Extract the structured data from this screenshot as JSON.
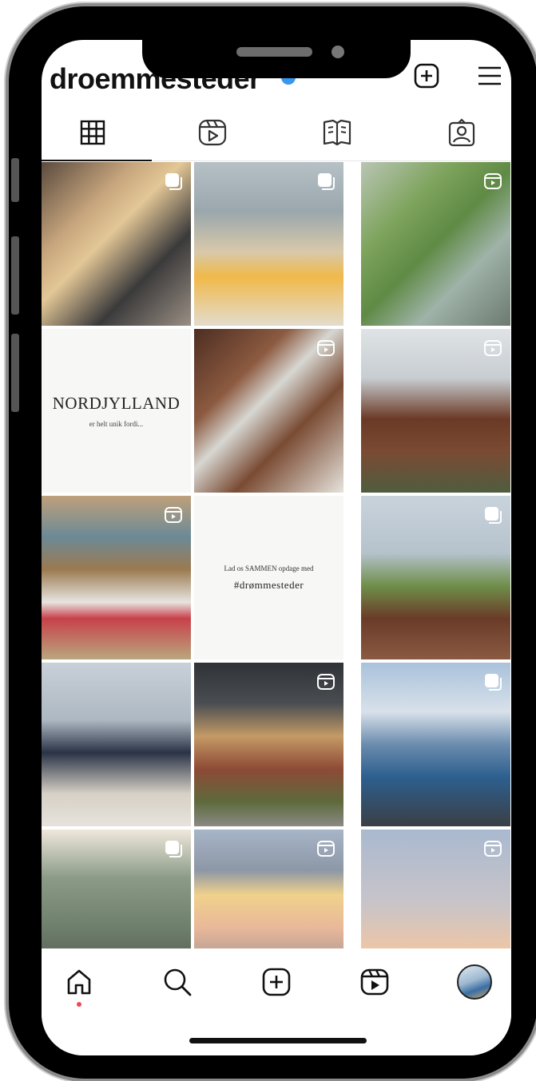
{
  "profile": {
    "username": "droemmesteder"
  },
  "tabs": [
    {
      "name": "posts-grid",
      "icon": "grid-icon",
      "active": true
    },
    {
      "name": "reels",
      "icon": "reels-icon",
      "active": false
    },
    {
      "name": "guides",
      "icon": "guide-icon",
      "active": false
    },
    {
      "name": "tagged",
      "icon": "tagged-icon",
      "active": false
    }
  ],
  "grid": {
    "tile_text_1": {
      "title": "NORDJYLLAND",
      "subtitle": "er helt unik fordi..."
    },
    "tile_text_2": {
      "line1": "Lad os SAMMEN opdage med",
      "line2": "#drømmesteder"
    }
  },
  "bottom_nav": [
    {
      "name": "home",
      "icon": "home-icon",
      "active": true
    },
    {
      "name": "search",
      "icon": "search-icon",
      "active": false
    },
    {
      "name": "create",
      "icon": "plus-square-icon",
      "active": false
    },
    {
      "name": "reels",
      "icon": "reels-icon",
      "active": false
    },
    {
      "name": "profile",
      "icon": "avatar",
      "active": false
    }
  ],
  "colors": {
    "accent_blue": "#3897f0",
    "active_dot": "#ed4956",
    "text": "#111111"
  }
}
